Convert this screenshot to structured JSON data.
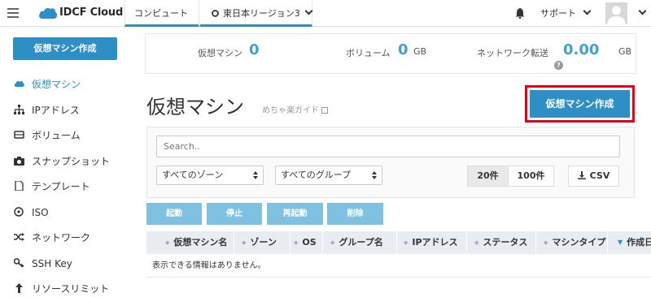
{
  "header": {
    "logo_text": "IDCF Cloud",
    "nav_compute": "コンピュート",
    "nav_region": "東日本リージョン3",
    "support": "サポート"
  },
  "sidebar": {
    "create_button": "仮想マシン作成",
    "items": [
      {
        "label": "仮想マシン",
        "icon": "cloud-icon"
      },
      {
        "label": "IPアドレス",
        "icon": "network-tree-icon"
      },
      {
        "label": "ボリューム",
        "icon": "drive-icon"
      },
      {
        "label": "スナップショット",
        "icon": "camera-icon"
      },
      {
        "label": "テンプレート",
        "icon": "document-icon"
      },
      {
        "label": "ISO",
        "icon": "disc-icon"
      },
      {
        "label": "ネットワーク",
        "icon": "shuffle-icon"
      },
      {
        "label": "SSH Key",
        "icon": "key-icon"
      },
      {
        "label": "リソースリミット",
        "icon": "arrow-up-icon"
      }
    ]
  },
  "stats": {
    "vm_label": "仮想マシン",
    "vm_value": "0",
    "volume_label": "ボリューム",
    "volume_value": "0",
    "volume_unit": "GB",
    "network_label": "ネットワーク転送",
    "network_value": "0.00",
    "network_unit": "GB",
    "help_glyph": "?"
  },
  "main": {
    "title": "仮想マシン",
    "guide_link": "めちゃ楽ガイド",
    "create_button": "仮想マシン作成",
    "search_placeholder": "Search..",
    "zone_select": "すべてのゾーン",
    "group_select": "すべてのグループ",
    "page_size_20": "20件",
    "page_size_100": "100件",
    "csv_label": "CSV",
    "actions": {
      "start": "起動",
      "stop": "停止",
      "restart": "再起動",
      "delete": "削除"
    },
    "columns": [
      "仮想マシン名",
      "ゾーン",
      "OS",
      "グループ名",
      "IPアドレス",
      "ステータス",
      "マシンタイプ",
      "作成日"
    ],
    "empty_message": "表示できる情報はありません。"
  },
  "colors": {
    "accent": "#2e8fc7",
    "highlight": "#e60012",
    "action_button": "#7fc1e0"
  }
}
